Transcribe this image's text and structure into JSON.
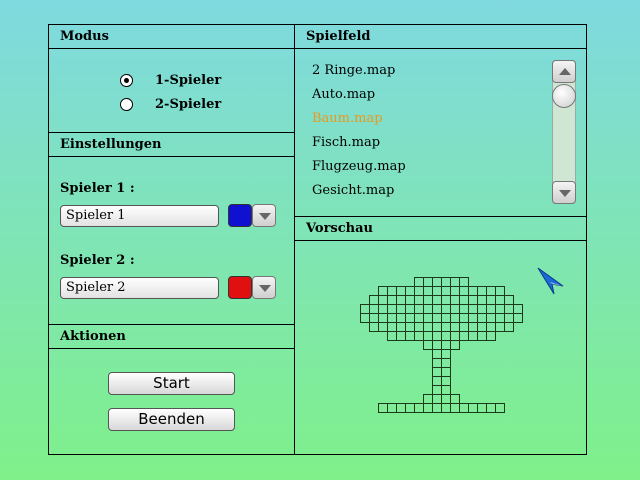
{
  "modus": {
    "title": "Modus",
    "options": [
      "1-Spieler",
      "2-Spieler"
    ],
    "selected_index": 0
  },
  "einstellungen": {
    "title": "Einstellungen",
    "player1": {
      "label": "Spieler 1 :",
      "name": "Spieler 1",
      "color": "#1010d0"
    },
    "player2": {
      "label": "Spieler 2 :",
      "name": "Spieler 2",
      "color": "#e01010"
    }
  },
  "aktionen": {
    "title": "Aktionen",
    "start_label": "Start",
    "quit_label": "Beenden"
  },
  "spielfeld": {
    "title": "Spielfeld",
    "items": [
      "2 Ringe.map",
      "Auto.map",
      "Baum.map",
      "Fisch.map",
      "Flugzeug.map",
      "Gesicht.map"
    ],
    "selected_index": 2,
    "selected_color": "#e89a20"
  },
  "vorschau": {
    "title": "Vorschau",
    "map_rows": [
      "......XXXXXX......",
      "..XXXXXXXXXXXXXX..",
      ".XXXXXXXXXXXXXXXX.",
      "XXXXXXXXXXXXXXXXXX",
      "XXXXXXXXXXXXXXXXXX",
      ".XXXXXXXXXXXXXXXX.",
      "...XXXXXXXXXXXX...",
      ".......XXXX.......",
      "........XX........",
      "........XX........",
      "........XX........",
      "........XX........",
      "........XX........",
      ".......XXXX.......",
      "..XXXXXXXXXXXXXX.."
    ]
  }
}
